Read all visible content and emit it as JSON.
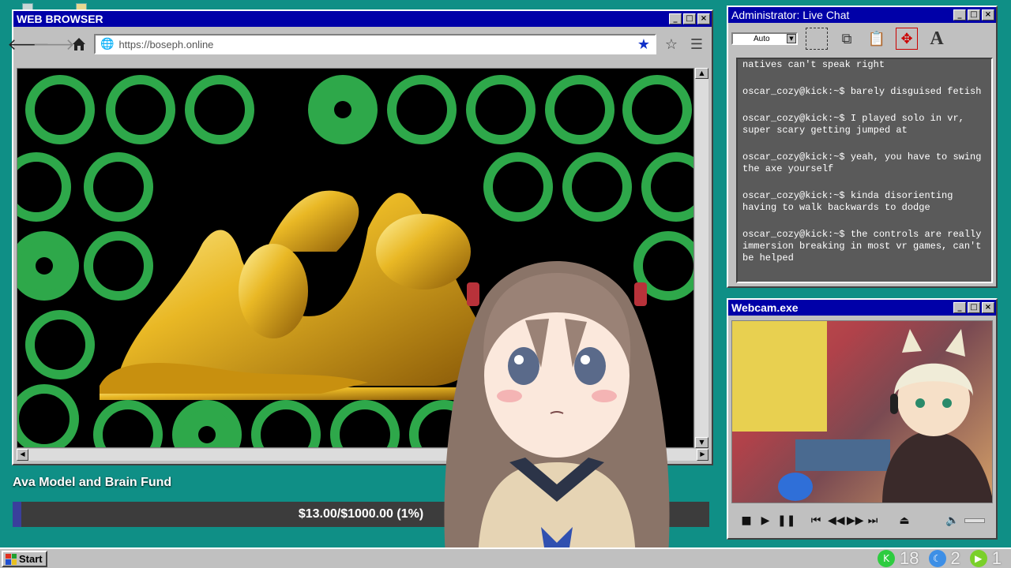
{
  "browser": {
    "title": "WEB BROWSER",
    "url": "https://boseph.online",
    "icons": {
      "back": "arrow-left-icon",
      "forward": "arrow-right-icon",
      "home": "home-icon",
      "globe": "globe-icon",
      "bookmark": "star-filled-icon",
      "favorite": "star-outline-icon",
      "menu": "hamburger-icon"
    }
  },
  "chat": {
    "title": "Administrator: Live Chat",
    "font_size_select": "Auto",
    "messages": [
      {
        "user": "",
        "text": "natives can't speak right"
      },
      {
        "user": "oscar_cozy@kick:~$",
        "text": "barely disguised fetish"
      },
      {
        "user": "oscar_cozy@kick:~$",
        "text": "I played solo in vr, super scary getting jumped at"
      },
      {
        "user": "oscar_cozy@kick:~$",
        "text": "yeah, you have to swing the axe yourself"
      },
      {
        "user": "oscar_cozy@kick:~$",
        "text": "kinda disorienting having to walk backwards to dodge"
      },
      {
        "user": "oscar_cozy@kick:~$",
        "text": "the controls are really immersion breaking in most vr games, can't be helped"
      }
    ]
  },
  "webcam": {
    "title": "Webcam.exe",
    "controls": [
      "stop-icon",
      "play-icon",
      "pause-icon",
      "skip-start-icon",
      "rewind-icon",
      "fast-forward-icon",
      "skip-end-icon",
      "eject-icon",
      "volume-icon"
    ]
  },
  "fund": {
    "title": "Ava Model and Brain Fund",
    "progress_text": "$13.00/$1000.00 (1%)",
    "progress_fraction": 0.013,
    "fill_color": "#3a3f9c"
  },
  "taskbar": {
    "start_label": "Start",
    "tray": [
      {
        "icon": "kick-icon",
        "count": "18",
        "color": "#2ecc40"
      },
      {
        "icon": "moon-icon",
        "count": "2",
        "color": "#3d8fe6"
      },
      {
        "icon": "play-circle-icon",
        "count": "1",
        "color": "#7ad02a"
      }
    ]
  },
  "window_buttons": {
    "minimize": "_",
    "maximize": "□",
    "close": "×"
  }
}
